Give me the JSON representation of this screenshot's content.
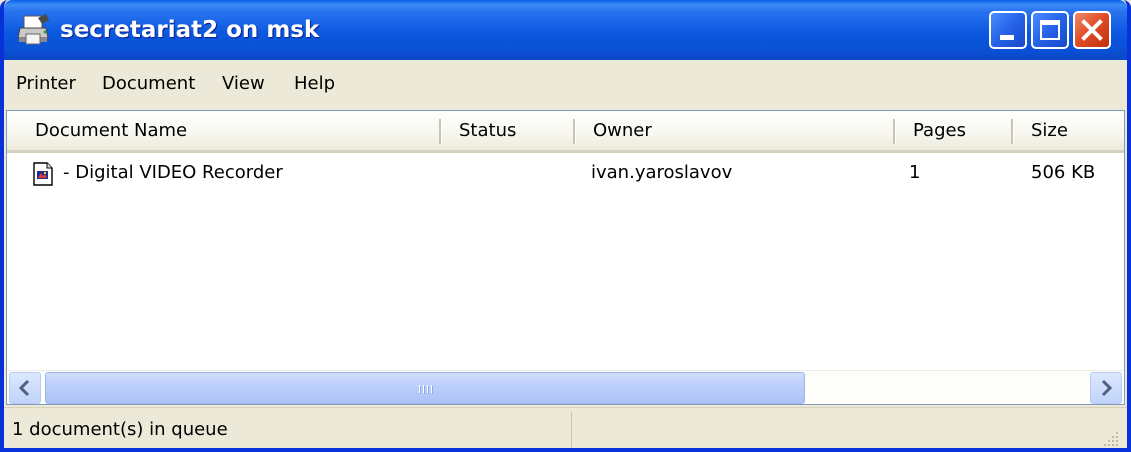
{
  "window": {
    "title": "secretariat2 on msk",
    "icon": "printer-icon",
    "controls": [
      "minimize-icon",
      "maximize-icon",
      "close-icon"
    ]
  },
  "menu": {
    "items": [
      {
        "label": "Printer"
      },
      {
        "label": "Document"
      },
      {
        "label": "View"
      },
      {
        "label": "Help"
      }
    ]
  },
  "list": {
    "columns": [
      {
        "label": "Document Name"
      },
      {
        "label": "Status"
      },
      {
        "label": "Owner"
      },
      {
        "label": "Pages"
      },
      {
        "label": "Size"
      }
    ],
    "rows": [
      {
        "icon": "document-icon",
        "name": "- Digital VIDEO Recorder",
        "status": "",
        "owner": "ivan.yaroslavov",
        "pages": "1",
        "size": "506 KB"
      }
    ]
  },
  "status_bar": {
    "text": "1 document(s) in queue"
  },
  "colors": {
    "titlebar": "#0A50D4",
    "window_bg": "#ECE9D8",
    "close_button": "#DE4A23"
  }
}
